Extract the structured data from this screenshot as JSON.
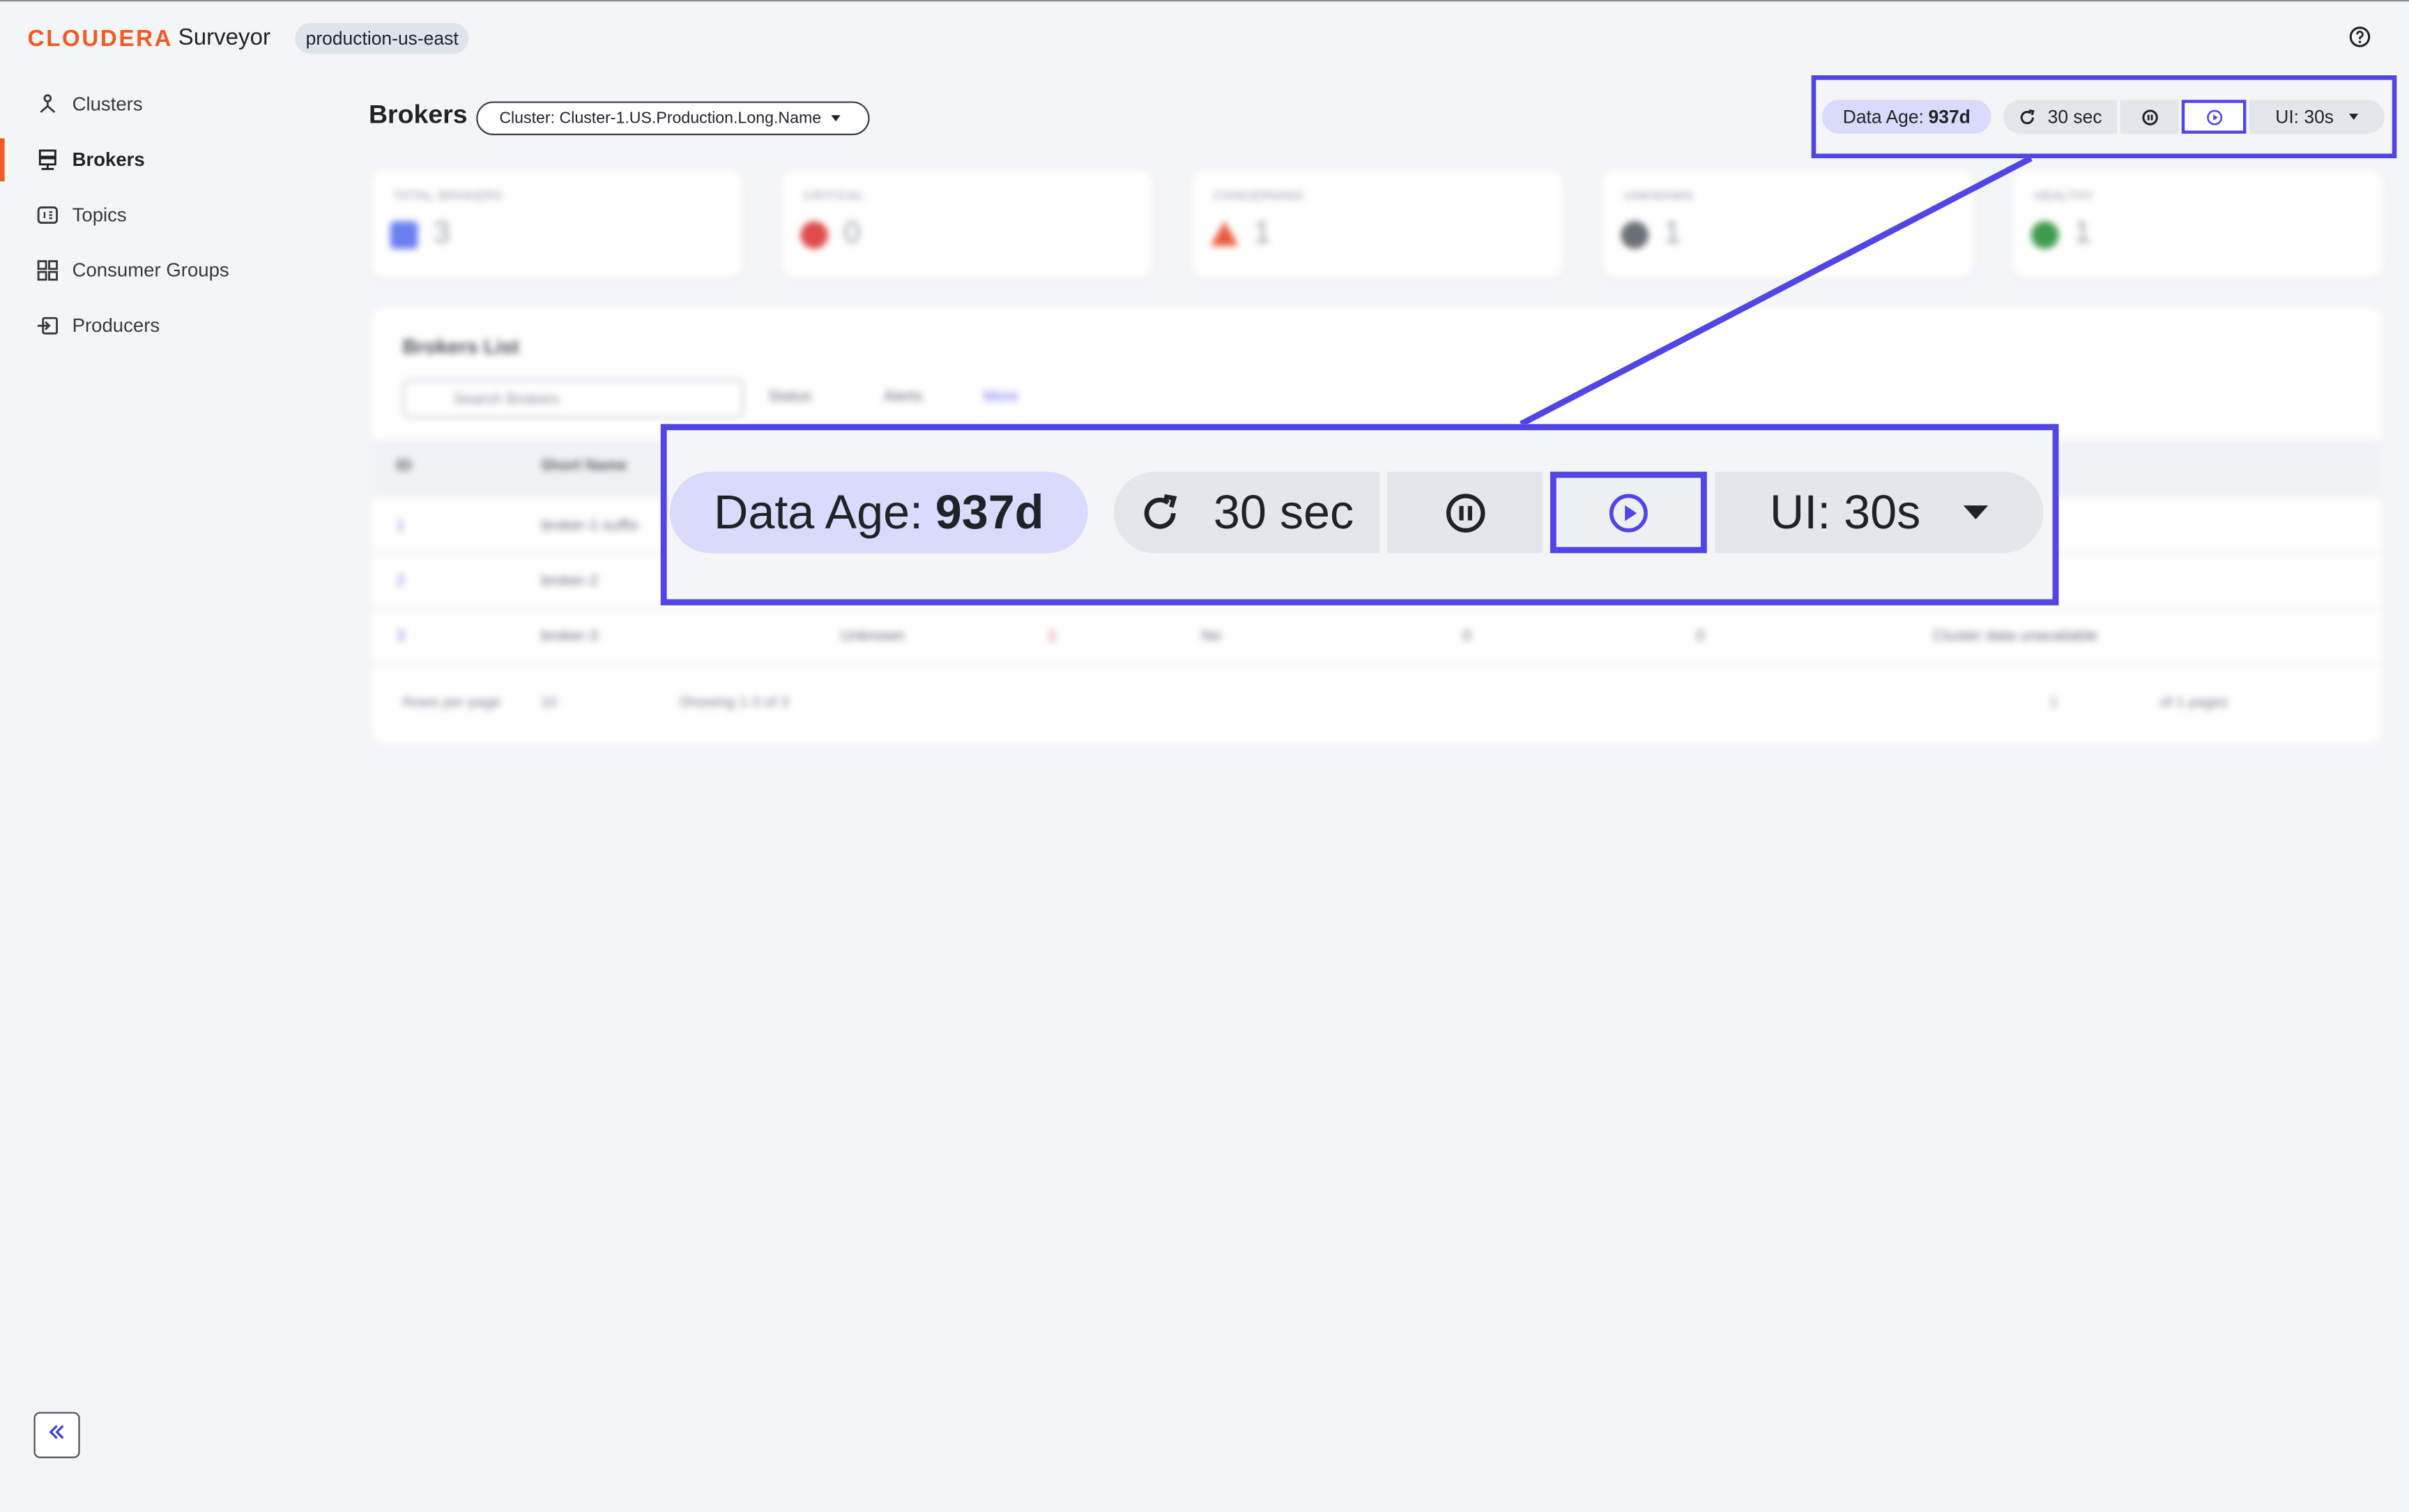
{
  "header": {
    "logo_text": "CLOUDERA",
    "product_name": "Surveyor",
    "environment": "production-us-east",
    "help_icon": "help-circle-icon"
  },
  "sidebar": {
    "items": [
      {
        "label": "Clusters",
        "icon": "cluster-icon",
        "active": false
      },
      {
        "label": "Brokers",
        "icon": "server-icon",
        "active": true
      },
      {
        "label": "Topics",
        "icon": "topic-icon",
        "active": false
      },
      {
        "label": "Consumer Groups",
        "icon": "grid-icon",
        "active": false
      },
      {
        "label": "Producers",
        "icon": "producer-icon",
        "active": false
      }
    ],
    "collapse_icon": "double-chevron-left-icon"
  },
  "page": {
    "title": "Brokers",
    "cluster_select": "Cluster:  Cluster-1.US.Production.Long.Name"
  },
  "toolbar": {
    "data_age_label": "Data Age: ",
    "data_age_value": "937d",
    "refresh_interval": "30 sec",
    "refresh_icon": "refresh-icon",
    "pause_icon": "pause-circle-icon",
    "play_icon": "play-circle-icon",
    "ui_refresh": "UI: 30s",
    "highlight_color": "#5145e6"
  },
  "stats": [
    {
      "label": "TOTAL BROKERS",
      "value": "3",
      "color": "#6b7ff0"
    },
    {
      "label": "CRITICAL",
      "value": "0",
      "color": "#e04a4a"
    },
    {
      "label": "CONCERNING",
      "value": "1",
      "color": "#e85a3a"
    },
    {
      "label": "UNKNOWN",
      "value": "1",
      "color": "#6a6f76"
    },
    {
      "label": "HEALTHY",
      "value": "1",
      "color": "#3e9a4d"
    }
  ],
  "brokers_list": {
    "title": "Brokers List",
    "search_placeholder": "Search Brokers",
    "filters": [
      "Status",
      "Alerts",
      "More"
    ],
    "columns": [
      "ID",
      "Short Name"
    ],
    "rows": [
      {
        "id": "1",
        "name": "broker-1-suffix",
        "status": "",
        "alerts": "",
        "col5": "",
        "col6": "",
        "col7": "",
        "note": ""
      },
      {
        "id": "2",
        "name": "broker-2",
        "status": "",
        "alerts": "",
        "col5": "",
        "col6": "",
        "col7": "",
        "note": ""
      },
      {
        "id": "3",
        "name": "broker-3",
        "status": "Unknown",
        "alerts": "1",
        "col5": "No",
        "col6": "0",
        "col7": "0",
        "note": "Cluster data unavailable"
      }
    ],
    "rows_per_page_label": "Rows per page",
    "rows_per_page": "10",
    "showing": "Showing 1-3 of 3",
    "page": "1",
    "of_pages": "of 1 pages"
  }
}
